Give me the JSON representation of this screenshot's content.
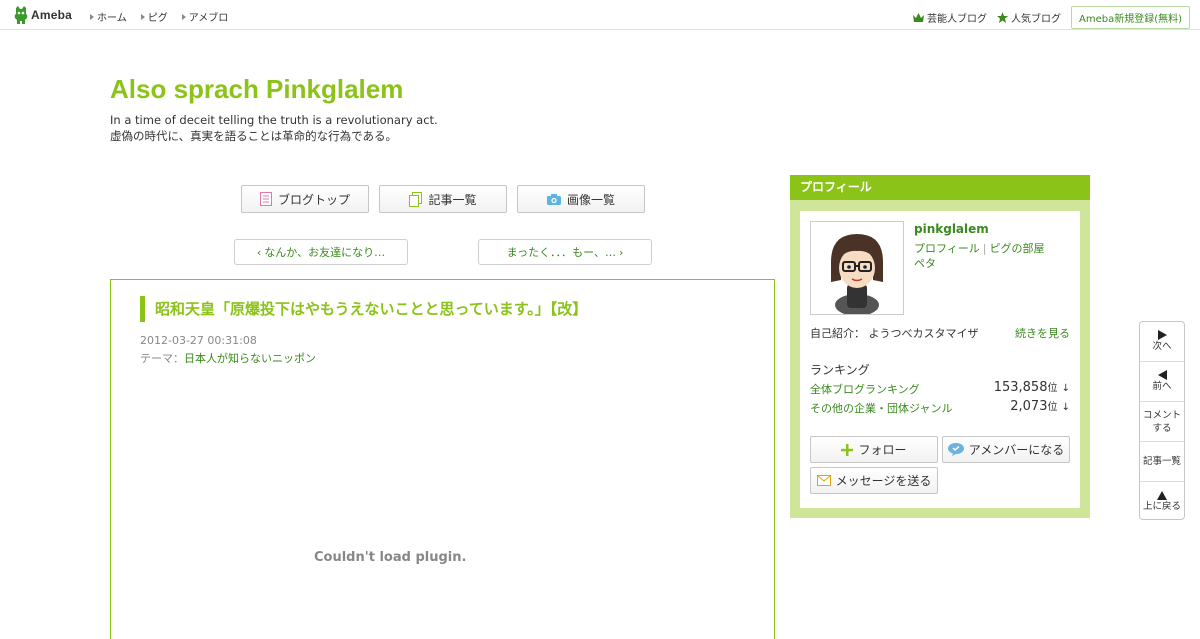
{
  "topbar": {
    "logo_text": "Ameba",
    "nav": [
      "ホーム",
      "ピグ",
      "アメブロ"
    ],
    "celebrity_blog": "芸能人ブログ",
    "popular_blog": "人気ブログ",
    "register": "Ameba新規登録(無料)"
  },
  "header": {
    "title": "Also sprach Pinkglalem",
    "desc_line1": "In a time of deceit telling the truth is a revolutionary act.",
    "desc_line2": "虚偽の時代に、真実を語ることは革命的な行為である。"
  },
  "nav_buttons": {
    "blog_top": "ブログトップ",
    "entries": "記事一覧",
    "images": "画像一覧"
  },
  "pager": {
    "prev": "なんか、お友達になり…",
    "next": "まったく．．．もー、…"
  },
  "article": {
    "title": "昭和天皇「原爆投下はやもうえないことと思っています。」【改】",
    "date": "2012-03-27 00:31:08",
    "theme_label": "テーマ：",
    "theme": "日本人が知らないニッポン",
    "plugin_msg": "Couldn't load plugin."
  },
  "profile": {
    "heading": "プロフィール",
    "name": "pinkglalem",
    "link_profile": "プロフィール",
    "link_pig": "ピグの部屋",
    "link_peta": "ペタ",
    "intro_label": "自己紹介：",
    "intro_text": "ようつべカスタマイザ",
    "intro_more": "続きを見る",
    "ranking_label": "ランキング",
    "rank1_name": "全体ブログランキング",
    "rank1_value": "153,858",
    "rank2_name": "その他の企業・団体ジャンル",
    "rank2_value": "2,073",
    "rank_unit": "位",
    "rank_arrow": "↓",
    "follow": "フォロー",
    "amember": "アメンバーになる",
    "message": "メッセージを送る"
  },
  "sidenav": {
    "next": "次へ",
    "prev": "前へ",
    "comment_line1": "コメント",
    "comment_line2": "する",
    "list": "記事一覧",
    "top": "上に戻る"
  },
  "colors": {
    "accent": "#8bc319",
    "link": "#3a8a1e",
    "profile_bg": "#cfe59a"
  }
}
